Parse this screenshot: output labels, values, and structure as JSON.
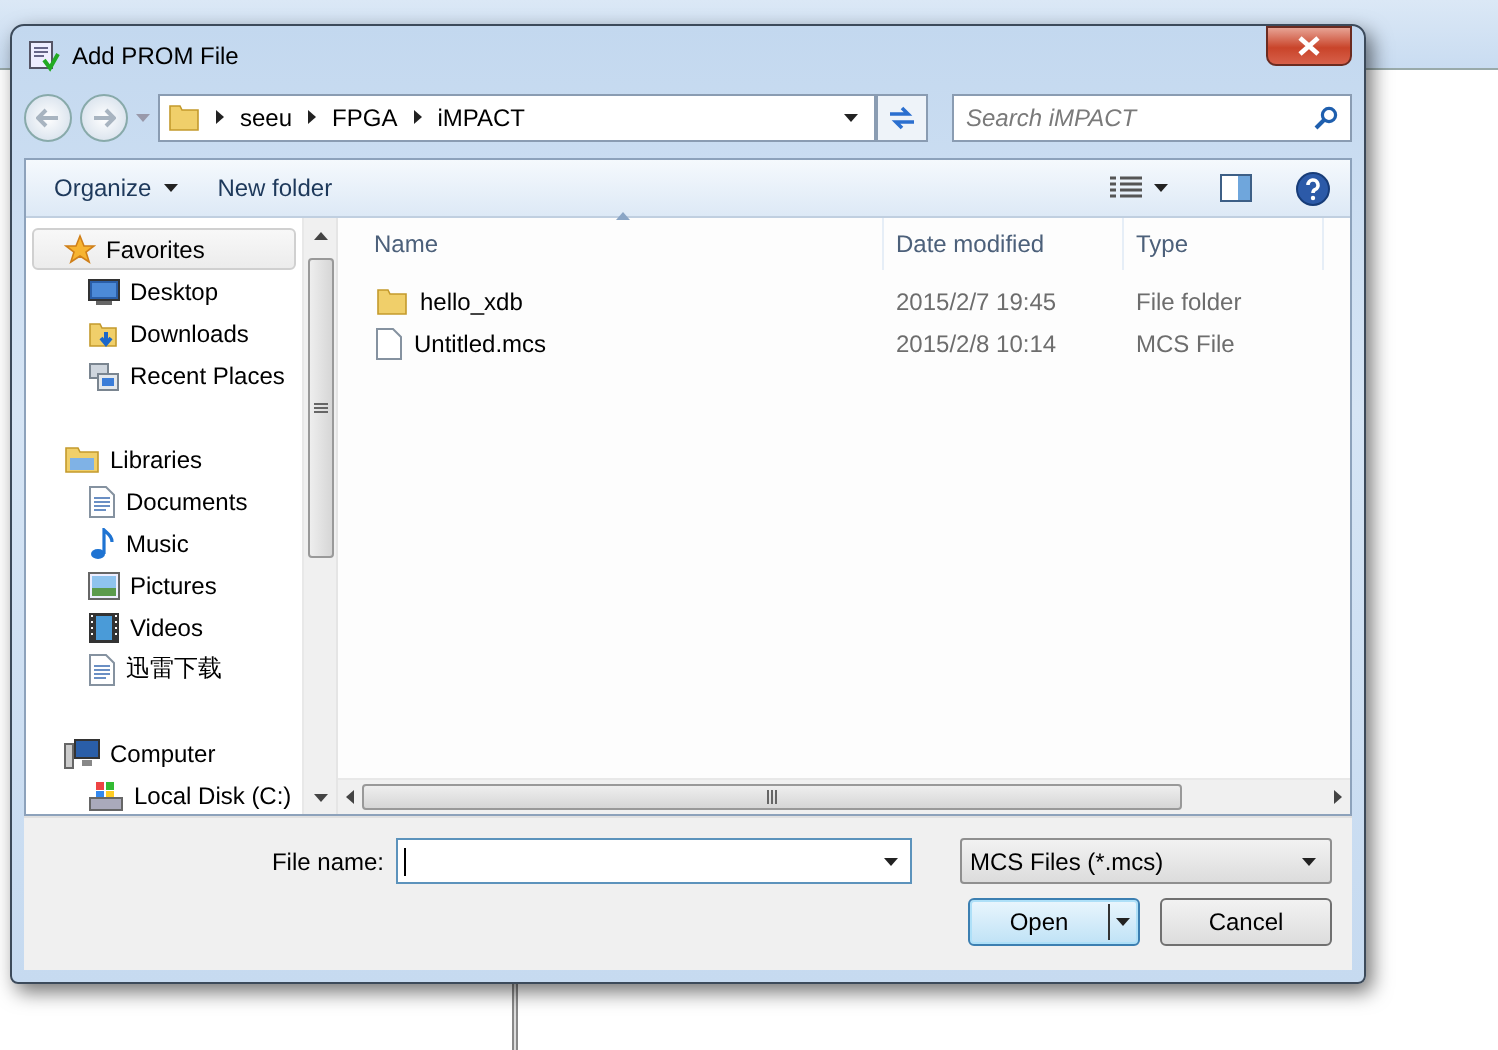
{
  "window": {
    "title": "Add PROM File"
  },
  "address": {
    "path": [
      "seeu",
      "FPGA",
      "iMPACT"
    ]
  },
  "search": {
    "placeholder": "Search iMPACT"
  },
  "toolbar": {
    "buttons": [
      {
        "label": "Organize",
        "kind": "menu"
      },
      {
        "label": "New folder",
        "kind": "plain"
      }
    ]
  },
  "nav": {
    "groups": [
      {
        "label": "Favorites",
        "kind": "star",
        "selected": true,
        "children": [
          {
            "label": "Desktop",
            "kind": "desktop",
            "selected": false
          },
          {
            "label": "Downloads",
            "kind": "downloads",
            "selected": false
          },
          {
            "label": "Recent Places",
            "kind": "recent",
            "selected": false
          }
        ]
      },
      {
        "label": "Libraries",
        "kind": "library",
        "selected": false,
        "children": [
          {
            "label": "Documents",
            "kind": "documents",
            "selected": false
          },
          {
            "label": "Music",
            "kind": "music",
            "selected": false
          },
          {
            "label": "Pictures",
            "kind": "pictures",
            "selected": false
          },
          {
            "label": "Videos",
            "kind": "videos",
            "selected": false
          },
          {
            "label": "迅雷下载",
            "kind": "documents",
            "selected": false
          }
        ]
      },
      {
        "label": "Computer",
        "kind": "computer",
        "selected": false,
        "children": [
          {
            "label": "Local Disk (C:)",
            "kind": "disk",
            "selected": false
          }
        ]
      }
    ]
  },
  "files": {
    "columns": [
      "Name",
      "Date modified",
      "Type"
    ],
    "rows": [
      {
        "kind": "folder",
        "name": "hello_xdb",
        "date": "2015/2/7 19:45",
        "type": "File folder"
      },
      {
        "kind": "file",
        "name": "Untitled.mcs",
        "date": "2015/2/8 10:14",
        "type": "MCS File"
      }
    ]
  },
  "file_name": {
    "label": "File name:"
  },
  "file_type": {
    "value": "MCS Files (*.mcs)"
  },
  "buttons": [
    {
      "label": "Open",
      "kind": "split",
      "default": true
    },
    {
      "label": "Cancel",
      "kind": "plain",
      "default": false
    }
  ]
}
